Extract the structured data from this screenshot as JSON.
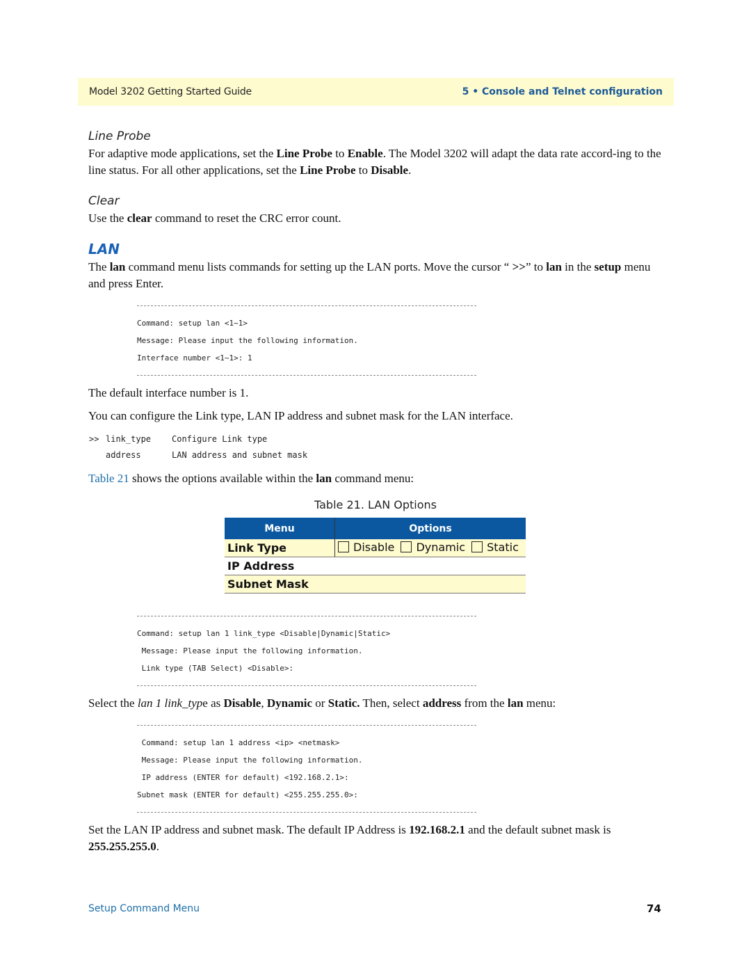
{
  "header": {
    "guide_title": "Model 3202 Getting Started Guide",
    "chapter": "5 • Console and Telnet configuration"
  },
  "line_probe": {
    "heading": "Line Probe",
    "text_parts": [
      "For adaptive mode applications, set the ",
      "Line Probe",
      " to ",
      "Enable",
      ". The Model 3202 will adapt the data rate accord-ing to the line status. For all other applications, set the ",
      "Line Probe",
      " to ",
      "Disable",
      "."
    ]
  },
  "clear": {
    "heading": "Clear",
    "text_parts": [
      "Use the ",
      "clear",
      " command to reset the CRC error count."
    ]
  },
  "lan": {
    "heading": "LAN",
    "intro_parts": [
      "The ",
      "lan",
      " command menu lists commands for setting up the LAN ports. Move the cursor “ ",
      ">>",
      "” to ",
      "lan",
      " in the ",
      "setup",
      " menu and press Enter."
    ],
    "code1": [
      "Command: setup lan <1~1>",
      "Message: Please input the following information.",
      "Interface number <1~1>: 1"
    ],
    "default_interface": "The default interface number is 1.",
    "configure_text": "You can configure the Link type, LAN IP address and subnet mask for the LAN interface.",
    "menu_items": [
      {
        "cursor": ">>",
        "command": "link_type",
        "description": "Configure Link type"
      },
      {
        "cursor": "",
        "command": "address",
        "description": "LAN address and subnet mask"
      }
    ],
    "table_ref_link": "Table 21",
    "table_ref_parts": [
      " shows the options available within the ",
      "lan",
      " command menu:"
    ],
    "table": {
      "caption": "Table 21. LAN Options",
      "headers": [
        "Menu",
        "Options"
      ],
      "rows": [
        {
          "menu": "Link Type",
          "options": [
            "Disable",
            "Dynamic",
            "Static"
          ]
        },
        {
          "menu": "IP Address",
          "options": []
        },
        {
          "menu": "Subnet Mask",
          "options": []
        }
      ]
    },
    "code2": [
      "Command: setup lan 1 link_type <Disable|Dynamic|Static>",
      " Message: Please input the following information.",
      " Link type (TAB Select) <Disable>:"
    ],
    "select_parts": [
      "Select the ",
      "lan 1 link_typ",
      "e as ",
      "Disable",
      ", ",
      "Dynamic",
      " or ",
      "Static.",
      " Then, select ",
      "address",
      " from the ",
      "lan",
      " menu:"
    ],
    "code3": [
      " Command: setup lan 1 address <ip> <netmask>",
      " Message: Please input the following information.",
      " IP address (ENTER for default) <192.168.2.1>:",
      "Subnet mask (ENTER for default) <255.255.255.0>:"
    ],
    "final_parts": [
      "Set the LAN IP address and subnet mask. The default IP Address is ",
      "192.168.2.1",
      " and the default subnet mask is ",
      "255.255.255.0",
      "."
    ]
  },
  "footer": {
    "section": "Setup Command Menu",
    "page_number": "74"
  },
  "colors": {
    "header_bg": "#fefbcf",
    "accent_blue": "#1c5a98",
    "table_header_bg": "#0b58a0",
    "link_blue": "#1e6fa8"
  }
}
